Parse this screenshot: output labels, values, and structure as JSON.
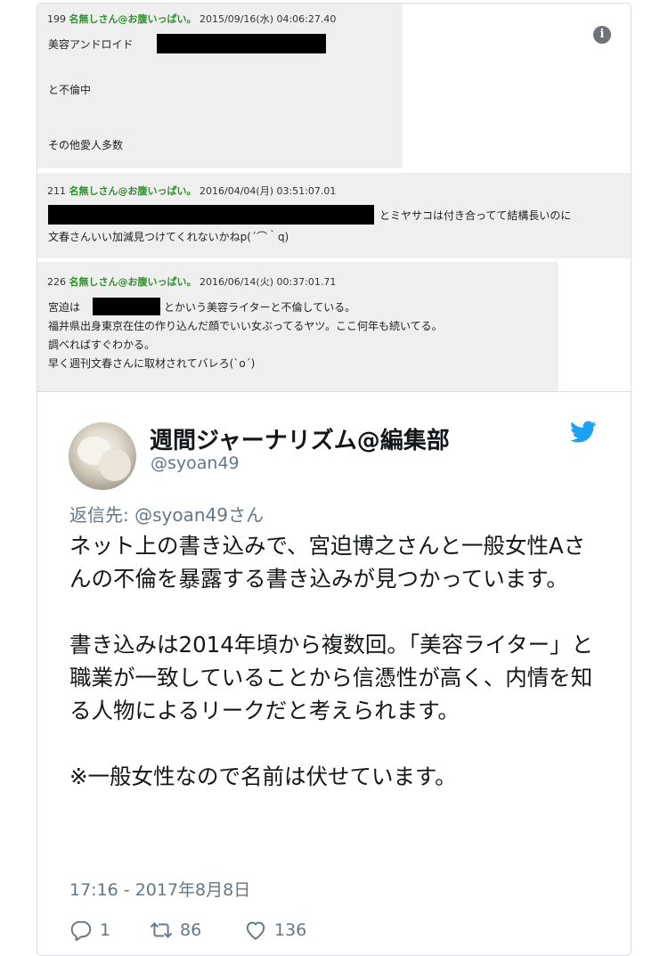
{
  "posts": [
    {
      "number": "199",
      "name": "名無しさん@お腹いっぱい。",
      "date": "2015/09/16(水) 04:06:27.40",
      "lines": [
        "美容アンドロイド",
        "と不倫中",
        "その他愛人多数"
      ]
    },
    {
      "number": "211",
      "name": "名無しさん@お腹いっぱい。",
      "date": "2016/04/04(月) 03:51:07.01",
      "lines": [
        "とミヤサコは付き合ってて結構長いのに",
        "文春さんいい加減見つけてくれないかねp(´⌒｀q)"
      ]
    },
    {
      "number": "226",
      "name": "名無しさん@お腹いっぱい。",
      "date": "2016/06/14(火) 00:37:01.71",
      "lines": [
        "宮迫は",
        "とかいう美容ライターと不倫している。",
        "福井県出身東京在住の作り込んだ顔でいい女ぶってるヤツ。ここ何年も続いてる。",
        "調べればすぐわかる。",
        "早く週刊文春さんに取材されてバレろ(`o´)"
      ]
    }
  ],
  "tweet": {
    "display_name": "週間ジャーナリズム@編集部",
    "handle": "@syoan49",
    "reply_to": "返信先: @syoan49さん",
    "text": "ネット上の書き込みで、宮迫博之さんと一般女性Aさんの不倫を暴露する書き込みが見つかっています。\n\n書き込みは2014年頃から複数回。「美容ライター」と職業が一致していることから信憑性が高く、内情を知る人物によるリークだと考えられます。\n\n※一般女性なので名前は伏せています。",
    "timestamp": "17:16 - 2017年8月8日",
    "reply_count": "1",
    "retweet_count": "86",
    "like_count": "136"
  },
  "icons": {
    "info": "info-icon",
    "twitter": "twitter-bird-icon",
    "reply": "reply-icon",
    "retweet": "retweet-icon",
    "like": "heart-icon"
  },
  "colors": {
    "post_bg": "#efefef",
    "poster_name": "#2f8f2f",
    "twitter_blue": "#1da1f2",
    "secondary_text": "#657786"
  }
}
